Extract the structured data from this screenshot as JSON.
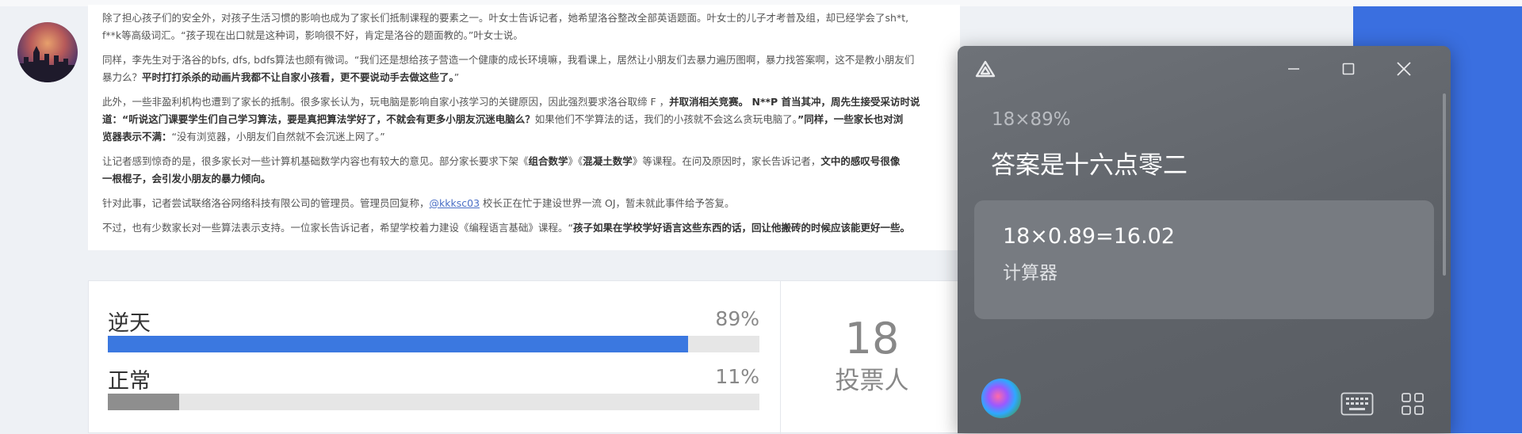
{
  "article": {
    "paragraphs": [
      [
        "除了担心孩子们的安全外，对孩子生活习惯的影响也成为了家长们抵制课程的要素之一。叶女士告诉记者，她希望洛谷整改全部英语题面。叶女士的儿子才考普及组，却已经学会了sh*t,"
      ],
      [
        "f**k等高级词汇。“孩子现在出口就是这种词，影响很不好，肯定是洛谷的题面教的。”叶女士说。"
      ],
      [
        "同样，李先生对于洛谷的bfs, dfs, bdfs算法也颇有微词。“我们还是想给孩子营造一个健康的成长环境嘛，我看课上，居然让小朋友们去暴力遍历图啊，暴力找答案啊，这不是教小朋友们"
      ],
      [
        "暴力么？",
        "平时打打杀杀的动画片我都不让自家小孩看，更不要说动手去做这些了。",
        "”"
      ],
      [
        "此外，一些非盈利机构也遭到了家长的抵制。很多家长认为，玩电脑是影响自家小孩学习的关键原因，因此强烈要求洛谷取缔 F ，",
        "并取消相关竞赛。 N**P 首当其冲，周先生接受采访时说"
      ],
      [
        "道：“听说这门课要学生们自己学习算法，要是真把算法学好了，不就会有更多小朋友沉迷电脑么？",
        "如果他们不学算法的话，我们的小孩就不会这么贪玩电脑了。",
        "”同样，一些家长也对浏"
      ],
      [
        "览器表示不满：",
        "“没有浏览器，小朋友们自然就不会沉迷上网了。”"
      ],
      [
        "让记者感到惊奇的是，很多家长对一些计算机基础数学内容也有较大的意见。部分家长要求下架《",
        "组合数学",
        "》《",
        "混凝土数学",
        "》等课程。在问及原因时，家长告诉记者，",
        "文中的感叹号很像"
      ],
      [
        "一根棍子，会引发小朋友的暴力倾向。"
      ],
      [
        "针对此事，记者尝试联络洛谷网络科技有限公司的管理员。管理员回复称，",
        "@kkksc03",
        " 校长正在忙于建设世界一流 OJ，暂未就此事件给予答复。"
      ],
      [
        "不过，也有少数家长对一些算法表示支持。一位家长告诉记者，希望学校着力建设《编程语言基础》课程。“",
        "孩子如果在学校学好语言这些东西的话，回让他搬砖的时候应该能更好一些。"
      ]
    ]
  },
  "poll": {
    "options": [
      {
        "label": "逆天",
        "percent_text": "89%",
        "fraction": 0.89,
        "color": "#3b78e0"
      },
      {
        "label": "正常",
        "percent_text": "11%",
        "fraction": 0.11,
        "color": "#8e8e8e"
      }
    ],
    "voters_count": "18",
    "voters_label": "投票人"
  },
  "assistant": {
    "query": "18×89%",
    "spoken_answer": "答案是十六点零二",
    "card_expression": "18×0.89=16.02",
    "card_source": "计算器"
  },
  "icons": {
    "logo": "app-logo-icon",
    "minimize": "minimize-icon",
    "maximize": "maximize-icon",
    "close": "close-icon",
    "voice": "voice-orb-icon",
    "keyboard": "keyboard-icon",
    "apps": "apps-grid-icon"
  }
}
